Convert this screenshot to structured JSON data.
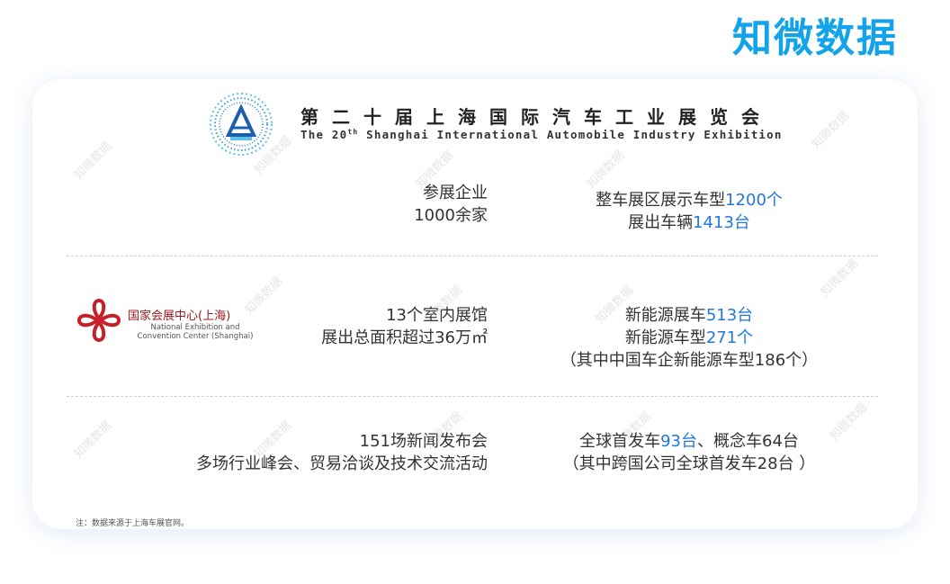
{
  "brand": "知微数据",
  "header": {
    "title_cn": "第二十届上海国际汽车工业展览会",
    "title_en_pre": "The 20",
    "title_en_sup": "th",
    "title_en_post": " Shanghai International Automobile Industry Exhibition"
  },
  "rows": [
    {
      "left": {
        "line1": "参展企业",
        "line2": "1000余家"
      },
      "right": {
        "line1_text": "整车展区展示车型",
        "line1_value": "1200个",
        "line2_text": "展出车辆",
        "line2_value": "1413台"
      }
    },
    {
      "left": {
        "line1": "13个室内展馆",
        "line2": "展出总面积超过36万㎡"
      },
      "right": {
        "line1_text": "新能源展车",
        "line1_value": "513台",
        "line2_text": "新能源车型",
        "line2_value": "271个",
        "line3": "（其中中国车企新能源车型186个）"
      }
    },
    {
      "left": {
        "line1": "151场新闻发布会",
        "line2": "多场行业峰会、贸易洽谈及技术交流活动"
      },
      "right": {
        "line1_pre": "全球首发车",
        "line1_value": "93台",
        "line1_post": "、概念车64台",
        "line2": "（其中跨国公司全球首发车28台 ）"
      }
    }
  ],
  "venue": {
    "name_cn": "国家会展中心(上海)",
    "name_en_line1": "National Exhibition and",
    "name_en_line2": "Convention Center (Shanghai)"
  },
  "footnote": "注：数据来源于上海车展官网。",
  "watermark": "知微数据",
  "colors": {
    "brand": "#12a3ea",
    "highlight": "#2277dd",
    "venue": "#c8202a"
  }
}
